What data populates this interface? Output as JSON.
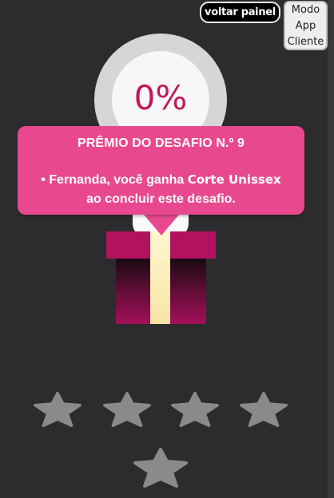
{
  "header": {
    "back_label": "voltar painel",
    "mode_lines": [
      "Modo",
      "App",
      "Cliente"
    ]
  },
  "progress": {
    "label": "0%",
    "value_percent": 0
  },
  "reward_popup": {
    "title": "PRÊMIO DO DESAFIO N.º 9",
    "line1_prefix": "• Fernanda, você ganha ",
    "reward_name": "Corte Unissex",
    "line2": "ao concluir este desafio."
  },
  "rating": {
    "stars_total": 5,
    "stars_filled": 0,
    "empty_color": "#8a8a8a"
  },
  "colors": {
    "accent": "#e8498e",
    "progress_text": "#c2185b",
    "background": "#2c2c2e"
  }
}
